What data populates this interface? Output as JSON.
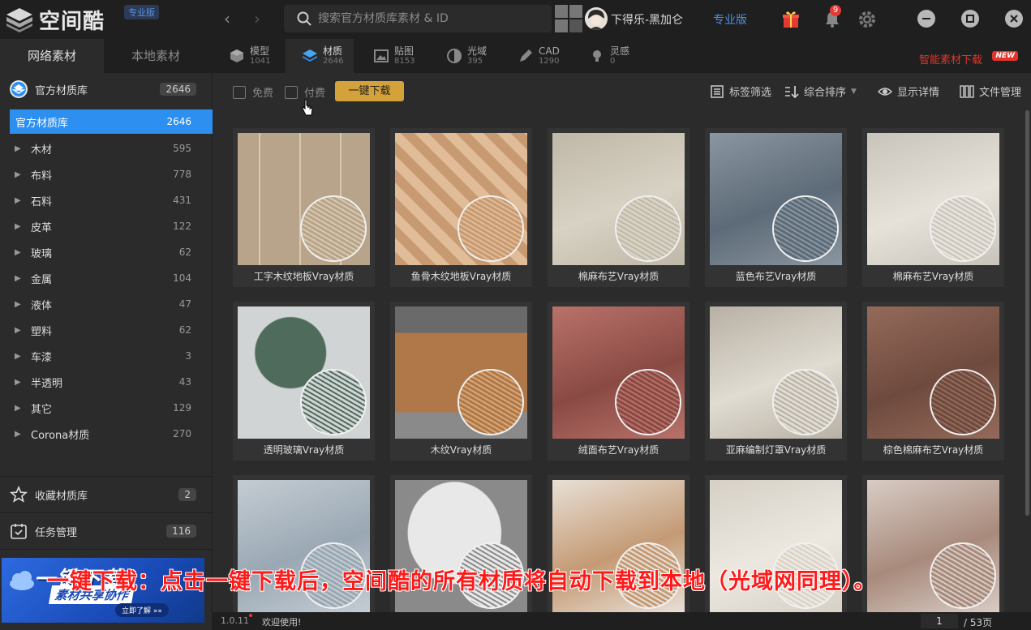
{
  "app": {
    "logo_text": "空间酷",
    "edition_tag": "专业版"
  },
  "header": {
    "search_placeholder": "搜索官方材质库素材 & ID",
    "username": "下得乐-黑加仑",
    "pro_label": "专业版",
    "notification_count": "9"
  },
  "left_tabs": [
    {
      "label": "网络素材"
    },
    {
      "label": "本地素材"
    }
  ],
  "category_tabs": [
    {
      "label": "模型",
      "count": "1041",
      "icon": "cube-icon"
    },
    {
      "label": "材质",
      "count": "2646",
      "icon": "layers-icon"
    },
    {
      "label": "贴图",
      "count": "8153",
      "icon": "image-icon"
    },
    {
      "label": "光域",
      "count": "395",
      "icon": "half-circle-icon"
    },
    {
      "label": "CAD",
      "count": "1290",
      "icon": "pen-icon"
    },
    {
      "label": "灵感",
      "count": "0",
      "icon": "bulb-icon"
    }
  ],
  "smart_download": {
    "label": "智能素材下载",
    "tag": "NEW"
  },
  "sidebar": {
    "library": {
      "label": "官方材质库",
      "count": "2646"
    },
    "selected": {
      "label": "官方材质库",
      "count": "2646"
    },
    "categories": [
      {
        "label": "木材",
        "count": "595"
      },
      {
        "label": "布料",
        "count": "778"
      },
      {
        "label": "石料",
        "count": "431"
      },
      {
        "label": "皮革",
        "count": "122"
      },
      {
        "label": "玻璃",
        "count": "62"
      },
      {
        "label": "金属",
        "count": "104"
      },
      {
        "label": "液体",
        "count": "47"
      },
      {
        "label": "塑料",
        "count": "62"
      },
      {
        "label": "车漆",
        "count": "3"
      },
      {
        "label": "半透明",
        "count": "43"
      },
      {
        "label": "其它",
        "count": "129"
      },
      {
        "label": "Corona材质",
        "count": "270"
      }
    ],
    "favorites": {
      "label": "收藏材质库",
      "count": "2"
    },
    "tasks": {
      "label": "任务管理",
      "count": "116"
    },
    "banner": {
      "title": "一键下载",
      "subtitle": "素材共享协作",
      "cta": "立即了解 »»"
    }
  },
  "toolbar": {
    "free_label": "免费",
    "paid_label": "付费",
    "download_all": "一键下载",
    "tag_filter": "标签筛选",
    "sort": "综合排序",
    "show_details": "显示详情",
    "file_manage": "文件管理"
  },
  "materials": [
    {
      "name": "工字木纹地板Vray材质",
      "c1": "#b8a48a",
      "c2": "#d8c8b0",
      "pattern": "planks"
    },
    {
      "name": "鱼骨木纹地板Vray材质",
      "c1": "#c89a72",
      "c2": "#e0bc98",
      "pattern": "herring"
    },
    {
      "name": "棉麻布艺Vray材质",
      "c1": "#d8d2c4",
      "c2": "#bfb8a8",
      "pattern": "fabric"
    },
    {
      "name": "蓝色布艺Vray材质",
      "c1": "#5d6b78",
      "c2": "#8a96a0",
      "pattern": "fabric"
    },
    {
      "name": "棉麻布艺Vray材质",
      "c1": "#e6e2da",
      "c2": "#c8c4bc",
      "pattern": "fabric"
    },
    {
      "name": "透明玻璃Vray材质",
      "c1": "#d0d4d4",
      "c2": "#4f6b5c",
      "pattern": "plant"
    },
    {
      "name": "木纹Vray材质",
      "c1": "#b07848",
      "c2": "#d8a878",
      "pattern": "wood"
    },
    {
      "name": "绒面布艺Vray材质",
      "c1": "#8a4a44",
      "c2": "#b8726a",
      "pattern": "fabric"
    },
    {
      "name": "亚麻编制灯罩Vray材质",
      "c1": "#e0dcd2",
      "c2": "#b8b0a4",
      "pattern": "fabric"
    },
    {
      "name": "棕色棉麻布艺Vray材质",
      "c1": "#6e4a3e",
      "c2": "#946a5a",
      "pattern": "fabric"
    },
    {
      "name": "",
      "c1": "#9aa8b4",
      "c2": "#c4ccd2",
      "pattern": "fabric"
    },
    {
      "name": "",
      "c1": "#e8e8e8",
      "c2": "#8a8a8a",
      "pattern": "marble"
    },
    {
      "name": "",
      "c1": "#c49a74",
      "c2": "#e8e0d6",
      "pattern": "fabric"
    },
    {
      "name": "",
      "c1": "#ece8e0",
      "c2": "#d6d0c6",
      "pattern": "fabric"
    },
    {
      "name": "",
      "c1": "#a88a7c",
      "c2": "#d8ccc4",
      "pattern": "fabric"
    }
  ],
  "status": {
    "version": "1.0.11",
    "welcome": "欢迎使用!",
    "current_page": "1",
    "total_pages": "/ 53页"
  },
  "overlay_caption": "一键下载：点击一键下载后，空间酷的所有材质将自动下载到本地（光域网同理）。",
  "colors": {
    "accent": "#2d8ff0",
    "download_button": "#d4a23a",
    "smart_download": "#e0352b",
    "caption": "#ff1a1a"
  }
}
